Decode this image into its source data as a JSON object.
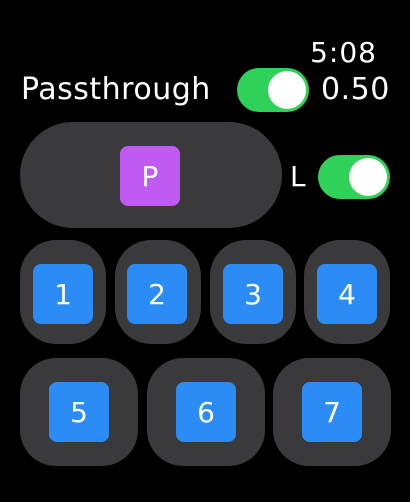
{
  "status": {
    "time": "5:08"
  },
  "passthrough": {
    "label": "Passthrough",
    "value": "0.50",
    "enabled": true
  },
  "p_button": {
    "label": "P",
    "color": "#bf5af2"
  },
  "l_toggle": {
    "label": "L",
    "enabled": true
  },
  "colors": {
    "accent_toggle": "#30d158",
    "button_blue": "#2a8cf4",
    "cell_bg": "#3a3a3c"
  },
  "buttons": {
    "b1": "1",
    "b2": "2",
    "b3": "3",
    "b4": "4",
    "b5": "5",
    "b6": "6",
    "b7": "7"
  }
}
